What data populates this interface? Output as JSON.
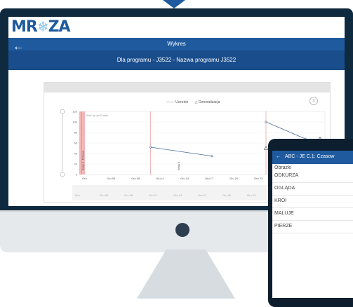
{
  "logo": {
    "prefix": "MR",
    "star": "❄",
    "suffix": "ZA"
  },
  "header": {
    "back_icon": "←",
    "title": "Wykres"
  },
  "subheader": {
    "text": "Dla programu - J3522 - Nazwa programu J3522"
  },
  "chart_data": {
    "type": "line",
    "legend": [
      "Uczenie",
      "Generalizacja"
    ],
    "credit": "JS chart by amCharts",
    "ylim": [
      0,
      120
    ],
    "yticks": [
      "0",
      "20",
      "40",
      "60",
      "80",
      "100",
      "120"
    ],
    "xticks": [
      "Gru",
      "Gru 05",
      "Gru 08",
      "Gru 11",
      "Gru 14",
      "Gru 17",
      "Gru 20",
      "Gru 23",
      "Gru 26",
      "Gru 29"
    ],
    "nav_ticks": [
      "Gru",
      "Gru 05",
      "Gru 08",
      "Gru 11",
      "Gru 14",
      "Gru 17",
      "Gru 20",
      "Gru 23",
      "Gru 26",
      "Gru 29"
    ],
    "series": [
      {
        "name": "Uczenie",
        "segments": [
          {
            "points": [
              [
                0.29,
                52
              ],
              [
                0.54,
                35
              ]
            ]
          },
          {
            "points": [
              [
                0.76,
                100
              ],
              [
                0.92,
                68
              ]
            ]
          }
        ]
      },
      {
        "name": "Generalizacja",
        "markers": [
          [
            0.76,
            50
          ],
          [
            0.98,
            68
          ]
        ]
      }
    ],
    "annotations": [
      {
        "text": "Sesja 4 - Przerwa",
        "x": 0.01
      },
      {
        "text": "Sesja 6",
        "x": 0.4
      }
    ]
  },
  "tablet": {
    "back_icon": "←",
    "title": "ABC - JE C.1: Czasow",
    "section_label": "Obrazki",
    "items": [
      "ODKURZA",
      "OGLĄDA",
      "KROI",
      "MALUJE",
      "PIERZE"
    ]
  }
}
